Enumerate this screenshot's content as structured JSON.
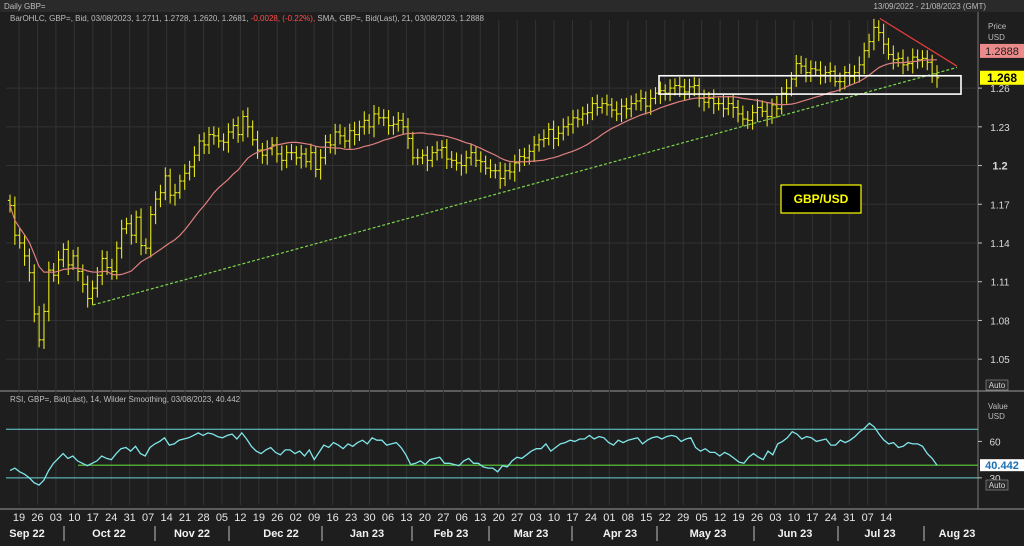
{
  "header": {
    "chart_title": "Daily GBP=",
    "date_range": "13/09/2022 - 21/08/2023 (GMT)",
    "price_legend": {
      "prefix": "BarOHLC, GBP=, Bid, 03/08/2023, 1.2711, 1.2728, 1.2620, 1.2681,",
      "change": "-0.0028, (-0.22%),",
      "sma": "SMA, GBP=, Bid(Last), 21, 03/08/2023, 1.2888"
    },
    "rsi_legend": "RSI, GBP=, Bid(Last), 14, Wilder Smoothing, 03/08/2023, 40.442"
  },
  "price_axis": {
    "title": "Price",
    "unit": "USD",
    "ticks": [
      "1.26",
      "1.23",
      "1.2",
      "1.17",
      "1.14",
      "1.11",
      "1.08",
      "1.05"
    ],
    "auto_label": "Auto",
    "sma_tag": "1.2888",
    "last_tag": "1.268"
  },
  "rsi_axis": {
    "title": "Value",
    "unit": "USD",
    "ticks": [
      "60",
      "30"
    ],
    "auto_label": "Auto",
    "last_tag": "40.442"
  },
  "annotation": "GBP/USD",
  "x_axis": {
    "days": [
      "19",
      "26",
      "03",
      "10",
      "17",
      "24",
      "31",
      "07",
      "14",
      "21",
      "28",
      "05",
      "12",
      "19",
      "26",
      "02",
      "09",
      "16",
      "23",
      "30",
      "06",
      "13",
      "20",
      "27",
      "06",
      "13",
      "20",
      "27",
      "03",
      "10",
      "17",
      "24",
      "01",
      "08",
      "15",
      "22",
      "29",
      "05",
      "12",
      "19",
      "26",
      "03",
      "10",
      "17",
      "24",
      "31",
      "07",
      "14"
    ],
    "months": [
      "Sep 22",
      "Oct 22",
      "Nov 22",
      "Dec 22",
      "Jan 23",
      "Feb 23",
      "Mar 23",
      "Apr 23",
      "May 23",
      "Jun 23",
      "Jul 23",
      "Aug 23"
    ]
  },
  "colors": {
    "background": "#1e1e1e",
    "bars": "#e8e81a",
    "sma": "#e07f7f",
    "trendline": "#7cd64b",
    "resistance": "#e23b3b",
    "rsi": "#7fe6ea",
    "rsi_bands": "#6ad3d6",
    "rsi_baseline": "#5fd13b",
    "last_tag_bg": "#ffff00",
    "sma_tag_bg": "#ea8a8a"
  },
  "chart_data": [
    {
      "type": "ohlc",
      "title": "Daily GBP=",
      "series_name": "GBP=",
      "ylabel": "Price USD",
      "ylim": [
        1.03,
        1.305
      ],
      "sma_period": 21,
      "sma_last": 1.2888,
      "last_ohlc": {
        "date": "2023-08-03",
        "open": 1.2711,
        "high": 1.2728,
        "low": 1.262,
        "close": 1.2681
      },
      "closes": [
        1.169,
        1.146,
        1.14,
        1.13,
        1.117,
        1.085,
        1.065,
        1.087,
        1.119,
        1.115,
        1.127,
        1.135,
        1.123,
        1.13,
        1.118,
        1.108,
        1.097,
        1.105,
        1.115,
        1.128,
        1.121,
        1.118,
        1.136,
        1.151,
        1.155,
        1.146,
        1.16,
        1.138,
        1.136,
        1.162,
        1.174,
        1.179,
        1.192,
        1.177,
        1.179,
        1.188,
        1.194,
        1.199,
        1.208,
        1.219,
        1.216,
        1.224,
        1.223,
        1.219,
        1.218,
        1.226,
        1.231,
        1.224,
        1.238,
        1.23,
        1.22,
        1.212,
        1.208,
        1.213,
        1.216,
        1.209,
        1.204,
        1.21,
        1.21,
        1.206,
        1.209,
        1.203,
        1.21,
        1.197,
        1.206,
        1.218,
        1.216,
        1.226,
        1.223,
        1.219,
        1.227,
        1.224,
        1.23,
        1.235,
        1.23,
        1.24,
        1.237,
        1.237,
        1.231,
        1.232,
        1.235,
        1.23,
        1.221,
        1.206,
        1.206,
        1.208,
        1.204,
        1.21,
        1.212,
        1.214,
        1.205,
        1.204,
        1.202,
        1.2,
        1.206,
        1.21,
        1.204,
        1.203,
        1.198,
        1.196,
        1.196,
        1.19,
        1.196,
        1.195,
        1.202,
        1.207,
        1.206,
        1.211,
        1.216,
        1.22,
        1.221,
        1.228,
        1.221,
        1.225,
        1.23,
        1.232,
        1.237,
        1.236,
        1.24,
        1.241,
        1.248,
        1.245,
        1.248,
        1.247,
        1.243,
        1.24,
        1.246,
        1.244,
        1.248,
        1.25,
        1.252,
        1.246,
        1.252,
        1.256,
        1.258,
        1.256,
        1.26,
        1.262,
        1.261,
        1.257,
        1.261,
        1.262,
        1.252,
        1.249,
        1.252,
        1.248,
        1.248,
        1.244,
        1.248,
        1.245,
        1.24,
        1.236,
        1.235,
        1.241,
        1.245,
        1.242,
        1.238,
        1.247,
        1.244,
        1.256,
        1.26,
        1.267,
        1.279,
        1.277,
        1.272,
        1.275,
        1.274,
        1.27,
        1.272,
        1.273,
        1.265,
        1.265,
        1.272,
        1.269,
        1.272,
        1.278,
        1.289,
        1.296,
        1.307,
        1.303,
        1.294,
        1.286,
        1.282,
        1.283,
        1.278,
        1.279,
        1.284,
        1.282,
        1.283,
        1.28,
        1.271,
        1.268
      ],
      "trendline": {
        "color": "green-dashed",
        "points": [
          [
            "2022-10-12",
            1.092
          ],
          [
            "2023-08-10",
            1.276
          ]
        ]
      },
      "resistance_line": {
        "color": "red",
        "points": [
          [
            "2023-07-14",
            1.314
          ],
          [
            "2023-08-10",
            1.277
          ]
        ]
      },
      "highlight_box": {
        "y_range": [
          1.26,
          1.268
        ]
      },
      "annotations": [
        "GBP/USD"
      ]
    },
    {
      "type": "line",
      "title": "RSI",
      "series_name": "RSI, GBP=, Bid(Last), 14, Wilder Smoothing",
      "ylabel": "Value USD",
      "ylim": [
        20,
        90
      ],
      "bands": [
        70,
        30
      ],
      "last_value": 40.442,
      "values": [
        36.0,
        38.0,
        35.0,
        33.0,
        30.0,
        26.0,
        24.0,
        28.0,
        36.0,
        42.0,
        46.0,
        50.0,
        46.0,
        48.0,
        44.0,
        42.0,
        40.0,
        42.0,
        44.0,
        48.0,
        46.0,
        45.0,
        50.0,
        54.0,
        55.0,
        52.0,
        56.0,
        50.0,
        48.0,
        55.0,
        58.0,
        60.0,
        63.0,
        57.0,
        58.0,
        61.0,
        62.0,
        63.0,
        65.0,
        67.0,
        65.0,
        67.0,
        66.0,
        64.0,
        63.0,
        65.0,
        66.0,
        62.0,
        67.0,
        62.0,
        56.0,
        52.0,
        50.0,
        53.0,
        55.0,
        51.0,
        49.0,
        53.0,
        53.0,
        50.0,
        52.0,
        48.0,
        53.0,
        45.0,
        51.0,
        57.0,
        55.0,
        59.0,
        57.0,
        54.0,
        58.0,
        56.0,
        59.0,
        61.0,
        58.0,
        63.0,
        61.0,
        61.0,
        57.0,
        58.0,
        59.0,
        55.0,
        49.0,
        41.0,
        42.0,
        44.0,
        41.0,
        45.0,
        46.0,
        47.0,
        42.0,
        42.0,
        41.0,
        40.0,
        44.0,
        46.0,
        42.0,
        42.0,
        39.0,
        38.0,
        38.0,
        35.0,
        40.0,
        39.0,
        44.0,
        47.0,
        46.0,
        49.0,
        52.0,
        54.0,
        54.0,
        58.0,
        52.0,
        55.0,
        58.0,
        59.0,
        61.0,
        60.0,
        62.0,
        62.0,
        65.0,
        62.0,
        64.0,
        63.0,
        59.0,
        57.0,
        61.0,
        59.0,
        61.0,
        62.0,
        63.0,
        58.0,
        61.0,
        63.0,
        64.0,
        62.0,
        64.0,
        65.0,
        64.0,
        60.0,
        62.0,
        63.0,
        55.0,
        52.0,
        54.0,
        51.0,
        51.0,
        48.0,
        51.0,
        49.0,
        46.0,
        43.0,
        42.0,
        47.0,
        50.0,
        47.0,
        45.0,
        52.0,
        49.0,
        58.0,
        60.0,
        63.0,
        68.0,
        66.0,
        62.0,
        64.0,
        63.0,
        60.0,
        61.0,
        62.0,
        57.0,
        57.0,
        61.0,
        59.0,
        61.0,
        64.0,
        68.0,
        71.0,
        75.0,
        72.0,
        66.0,
        61.0,
        58.0,
        59.0,
        55.0,
        56.0,
        59.0,
        58.0,
        58.0,
        56.0,
        50.0,
        46.0,
        40.442
      ]
    }
  ]
}
